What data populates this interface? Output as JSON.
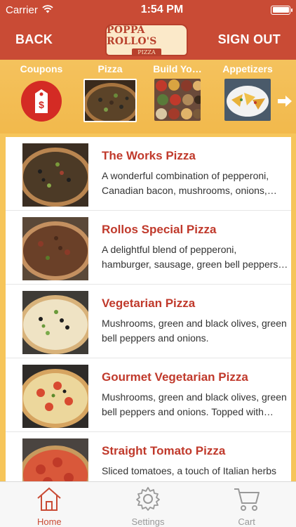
{
  "status_bar": {
    "carrier": "Carrier",
    "time": "1:54 PM"
  },
  "nav": {
    "back_label": "BACK",
    "sign_out_label": "SIGN OUT",
    "logo_main": "POPPA ROLLO'S",
    "logo_sub": "PIZZA"
  },
  "categories": [
    {
      "label": "Coupons",
      "icon": "coupon-tag-icon"
    },
    {
      "label": "Pizza",
      "icon": "pizza-thumbnail"
    },
    {
      "label": "Build Yo…",
      "icon": "toppings-thumbnail"
    },
    {
      "label": "Appetizers",
      "icon": "appetizers-thumbnail"
    }
  ],
  "items": [
    {
      "title": "The Works Pizza",
      "description": "A wonderful combination of pepperoni, Canadian bacon, mushrooms, onions, green peppers and olives."
    },
    {
      "title": "Rollos Special Pizza",
      "description": "A delightful blend of pepperoni, hamburger, sausage, green bell peppers, onions and mushrooms."
    },
    {
      "title": "Vegetarian Pizza",
      "description": "Mushrooms, green and black olives, green bell peppers and onions."
    },
    {
      "title": "Gourmet Vegetarian Pizza",
      "description": "Mushrooms, green and black olives, green bell peppers and onions. Topped with sliced tomatoes."
    },
    {
      "title": "Straight Tomato Pizza",
      "description": "Sliced tomatoes, a touch of Italian herbs"
    }
  ],
  "tabs": [
    {
      "label": "Home",
      "icon": "home-icon",
      "active": true
    },
    {
      "label": "Settings",
      "icon": "gear-icon",
      "active": false
    },
    {
      "label": "Cart",
      "icon": "cart-icon",
      "active": false
    }
  ],
  "colors": {
    "brand_red": "#c94b35",
    "title_red": "#c0392b",
    "background_gold": "#f6c55a",
    "coupon_red": "#d42b24"
  }
}
